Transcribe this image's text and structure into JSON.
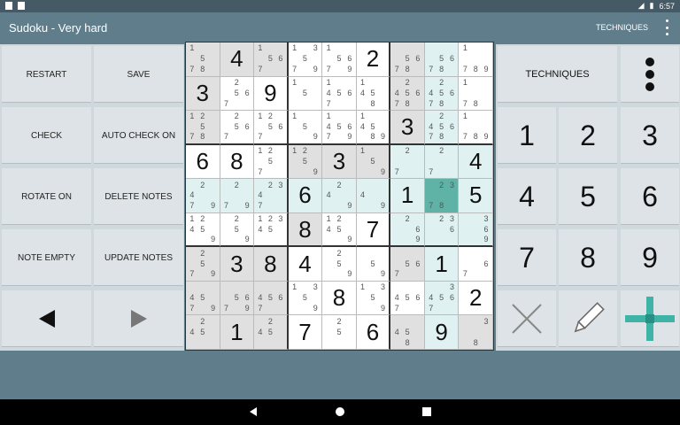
{
  "status": {
    "time": "6:57"
  },
  "appbar": {
    "title": "Sudoku - Very hard",
    "techniques": "TECHNIQUES"
  },
  "left_buttons": [
    {
      "label": "RESTART"
    },
    {
      "label": "SAVE"
    },
    {
      "label": "CHECK"
    },
    {
      "label": "AUTO CHECK ON"
    },
    {
      "label": "ROTATE ON"
    },
    {
      "label": "DELETE NOTES"
    },
    {
      "label": "NOTE EMPTY"
    },
    {
      "label": "UPDATE NOTES"
    }
  ],
  "right_panel": {
    "techniques": "TECHNIQUES",
    "numbers": [
      "1",
      "2",
      "3",
      "4",
      "5",
      "6",
      "7",
      "8",
      "9"
    ]
  },
  "grid": [
    [
      {
        "n": "1 5 78"
      },
      {
        "v": "4"
      },
      {
        "n": "1 56 7"
      },
      {
        "n": "13 5 79"
      },
      {
        "n": "1 569 79"
      },
      {
        "v": "2"
      },
      {
        "n": "56 78"
      },
      {
        "n": "56 78"
      },
      {
        "n": "1 789"
      }
    ],
    [
      {
        "v": "3"
      },
      {
        "n": "2 56 7"
      },
      {
        "v": "9"
      },
      {
        "n": "1 5"
      },
      {
        "n": "1 456 7"
      },
      {
        "n": "1 45 8"
      },
      {
        "n": "2 456 78"
      },
      {
        "n": "2 456 78"
      },
      {
        "n": "1 78"
      }
    ],
    [
      {
        "n": "12 5 78"
      },
      {
        "n": "2 56 7"
      },
      {
        "n": "12 56 7"
      },
      {
        "n": "1 5 9"
      },
      {
        "n": "1 456 79"
      },
      {
        "n": "1 45 89"
      },
      {
        "v": "3"
      },
      {
        "n": "2 456 78"
      },
      {
        "n": "1 789"
      }
    ],
    [
      {
        "v": "6"
      },
      {
        "v": "8"
      },
      {
        "n": "12 5 7"
      },
      {
        "n": "12 5 9"
      },
      {
        "v": "3"
      },
      {
        "n": "1 5 9"
      },
      {
        "n": "2 7"
      },
      {
        "n": "2 7"
      },
      {
        "v": "4"
      }
    ],
    [
      {
        "n": "2 4 79"
      },
      {
        "n": "2 7 9"
      },
      {
        "n": "23 4 7"
      },
      {
        "v": "6"
      },
      {
        "n": "2 4 9"
      },
      {
        "n": "4 9"
      },
      {
        "v": "1"
      },
      {
        "n": "23 78"
      },
      {
        "v": "5"
      }
    ],
    [
      {
        "n": "12 45 9"
      },
      {
        "n": "2 5 9"
      },
      {
        "n": "123 45"
      },
      {
        "v": "8"
      },
      {
        "n": "12 45 9"
      },
      {
        "v": "7"
      },
      {
        "n": "2 6 9"
      },
      {
        "n": "23 6"
      },
      {
        "n": "3 6 9"
      }
    ],
    [
      {
        "n": "2 5 79"
      },
      {
        "v": "3"
      },
      {
        "v": "8"
      },
      {
        "v": "4"
      },
      {
        "n": "2 5 9"
      },
      {
        "n": "5 9"
      },
      {
        "n": "56 7"
      },
      {
        "v": "1"
      },
      {
        "n": "6 7"
      }
    ],
    [
      {
        "n": "45 7 9"
      },
      {
        "n": "56 79"
      },
      {
        "n": "456 7"
      },
      {
        "n": "13 5 9"
      },
      {
        "v": "8"
      },
      {
        "n": "13 5 9"
      },
      {
        "n": "456 7"
      },
      {
        "n": "3 456 7"
      },
      {
        "v": "2"
      }
    ],
    [
      {
        "n": "2 45"
      },
      {
        "v": "1"
      },
      {
        "n": "2 45"
      },
      {
        "v": "7"
      },
      {
        "n": "2 5"
      },
      {
        "v": "6"
      },
      {
        "n": "45 8"
      },
      {
        "v": "9"
      },
      {
        "n": "3 8"
      }
    ]
  ]
}
